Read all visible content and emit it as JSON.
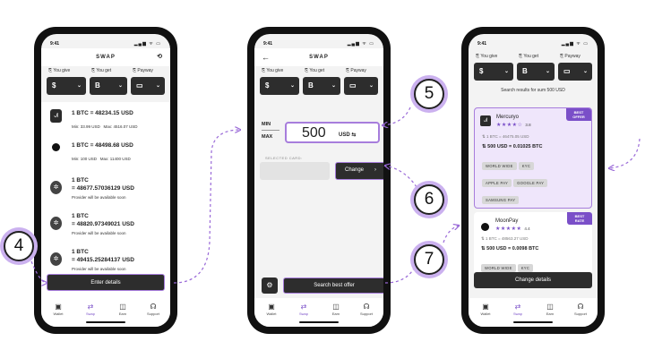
{
  "status_time": "9:41",
  "phone1": {
    "title": "SWAP",
    "labels": {
      "you_give": "You give",
      "you_get": "You get",
      "payway": "Payway"
    },
    "dropdowns": {
      "give": "$",
      "get": "B"
    },
    "providers": [
      {
        "rate": "1 BTC = 48234.15 USD",
        "min": "Min: 33.99 USD",
        "max": "Max: 4516.07 USD"
      },
      {
        "rate": "1 BTC = 48498.68 USD",
        "min": "Min: 100 USD",
        "max": "Max: 11400 USD"
      },
      {
        "rate_line1": "1 BTC",
        "rate_line2": "= 48677.57036129 USD",
        "note": "Provider will be available soon"
      },
      {
        "rate_line1": "1 BTC",
        "rate_line2": "= 48820.97349021 USD",
        "note": "Provider will be available soon"
      },
      {
        "rate_line1": "1 BTC",
        "rate_line2": "= 49415.25284137 USD",
        "note": "Provider will be available soon"
      }
    ],
    "button": "Enter details"
  },
  "phone2": {
    "title": "SWAP",
    "labels": {
      "you_give": "You give",
      "you_get": "You get",
      "payway": "Payway"
    },
    "dropdowns": {
      "give": "$",
      "get": "B"
    },
    "min_label": "MIN",
    "max_label": "MAX",
    "amount": "500",
    "currency": "USD",
    "selected_card_label": "SELECTED CARD:",
    "change_button": "Change",
    "search_button": "Search best offer"
  },
  "phone3": {
    "labels": {
      "you_give": "You give",
      "you_get": "You get",
      "payway": "Payway"
    },
    "dropdowns": {
      "give": "$",
      "get": "B"
    },
    "results_text": "Search results for sum 500 USD",
    "offers": [
      {
        "name": "Mercuryo",
        "badge": "BEST OFFER",
        "rating": "3.8",
        "stars": "★★★★☆",
        "rate": "1 BTC = 46475.05 USD",
        "amount": "500 USD = 0.01025 BTC",
        "tags": [
          "WORLD WIDE",
          "KYC",
          "APPLE PAY",
          "GOOGLE PAY",
          "SAMSUNG PAY"
        ]
      },
      {
        "name": "MoonPay",
        "badge": "BEST RATE",
        "rating": "4.4",
        "stars": "★★★★★",
        "rate": "1 BTC = 48563.27 USD",
        "amount": "500 USD = 0.0098 BTC",
        "tags": [
          "WORLD WIDE",
          "KYC"
        ]
      }
    ],
    "button": "Change details"
  },
  "nav": [
    "Wallet",
    "Swap",
    "Earn",
    "Support"
  ],
  "steps": [
    "4",
    "5",
    "6",
    "7"
  ],
  "colors": {
    "accent": "#7a4fc8",
    "accent_light": "#cbb1ef",
    "dark": "#2d2d2d"
  }
}
